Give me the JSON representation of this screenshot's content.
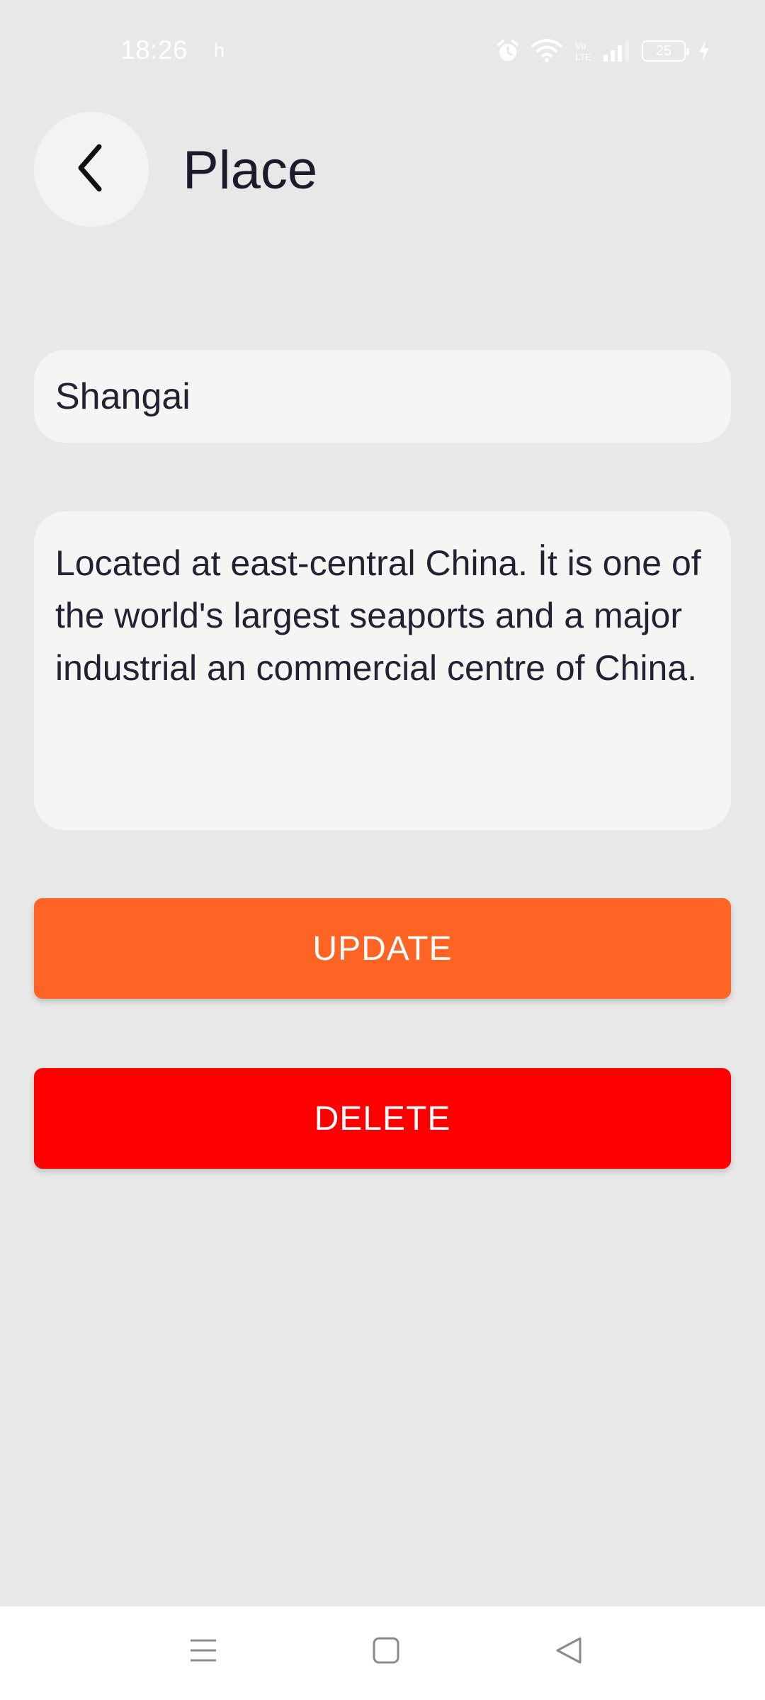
{
  "status_bar": {
    "time": "18:26",
    "extra": "h",
    "battery": "25",
    "icons": [
      "alarm-icon",
      "wifi-icon",
      "volte-icon",
      "signal-icon",
      "battery-icon",
      "charging-icon"
    ]
  },
  "header": {
    "title": "Place",
    "back_icon": "chevron-left-icon"
  },
  "form": {
    "name_value": "Shangai",
    "description_value": "Located at east-central China. İt is one of the world's largest seaports and a major industrial an commercial centre of China."
  },
  "actions": {
    "update_label": "UPDATE",
    "delete_label": "DELETE",
    "update_color": "#ff6424",
    "delete_color": "#ff0000"
  },
  "nav_bar": {
    "icons": [
      "menu-icon",
      "home-square-icon",
      "back-triangle-icon"
    ]
  },
  "colors": {
    "background": "#e8e8e8",
    "field_background": "#f6f5f3",
    "title_text": "#1a1b2b"
  }
}
